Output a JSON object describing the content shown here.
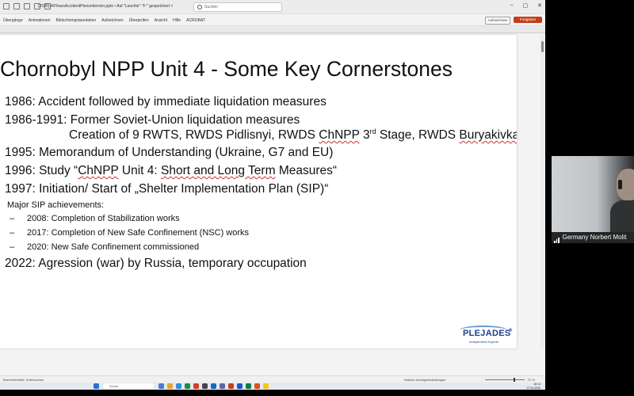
{
  "window": {
    "doc_title": "(2026) 40YearsAccidentPlenumlernen.pptx • Auf \"Leuchte\" \"F:\" gespeichert ˅",
    "search_placeholder": "Suchen",
    "min": "–",
    "max": "▢",
    "close": "✕"
  },
  "ribbon": {
    "tabs": [
      "Übergänge",
      "Animationen",
      "Bildschirmpräsentation",
      "Aufzeichnen",
      "Überprüfen",
      "Ansicht",
      "Hilfe",
      "ACROBAT"
    ],
    "record_button": "Aufzeichnen",
    "share_button": "Freigeben"
  },
  "slide": {
    "title": "Chornobyl NPP Unit 4 - Some Key Cornerstones",
    "items": [
      "1986: Accident followed by immediate liquidation measures",
      "1986-1991: Former Soviet-Union liquidation measures",
      "1995: Memorandum of Understanding (Ukraine, G7 and EU)",
      "2022: Agression (war) by Russia, temporary occupation"
    ],
    "subline": {
      "a": "Creation of 9 RWTS, RWDS Pidlisnyi, RWDS ",
      "b": "ChNPP",
      "c": " 3",
      "d": "rd",
      "e": " Stage, RWDS ",
      "f": "Buryakivka"
    },
    "study": {
      "a": "1996: Study “",
      "b": "ChNPP",
      "c": " Unit 4: ",
      "d": "Short and Long Term",
      "e": " Measures“"
    },
    "initiation": "1997: Initiation/ Start of „Shelter Implementation Plan (SIP)“",
    "achievements_heading": "Major SIP achievements:",
    "dash": "–",
    "achievements": [
      "2008: Completion of Stabilization works",
      "2017: Completion of New Safe Confinement (NSC) works",
      "2020: New Safe Confinement commissioned"
    ],
    "logo_text": "PLEJADES",
    "logo_sub": "Independent Experts"
  },
  "statusbar": {
    "left": "Barrierefreiheit: Untersuchen",
    "mid": "Notizen     Anzeigeeinstellungen",
    "zoom": "27 %"
  },
  "taskbar": {
    "search": "Suche",
    "time": "18:14",
    "date": "27.04.2026"
  },
  "video": {
    "participant": "Germany Norbert Molit"
  }
}
